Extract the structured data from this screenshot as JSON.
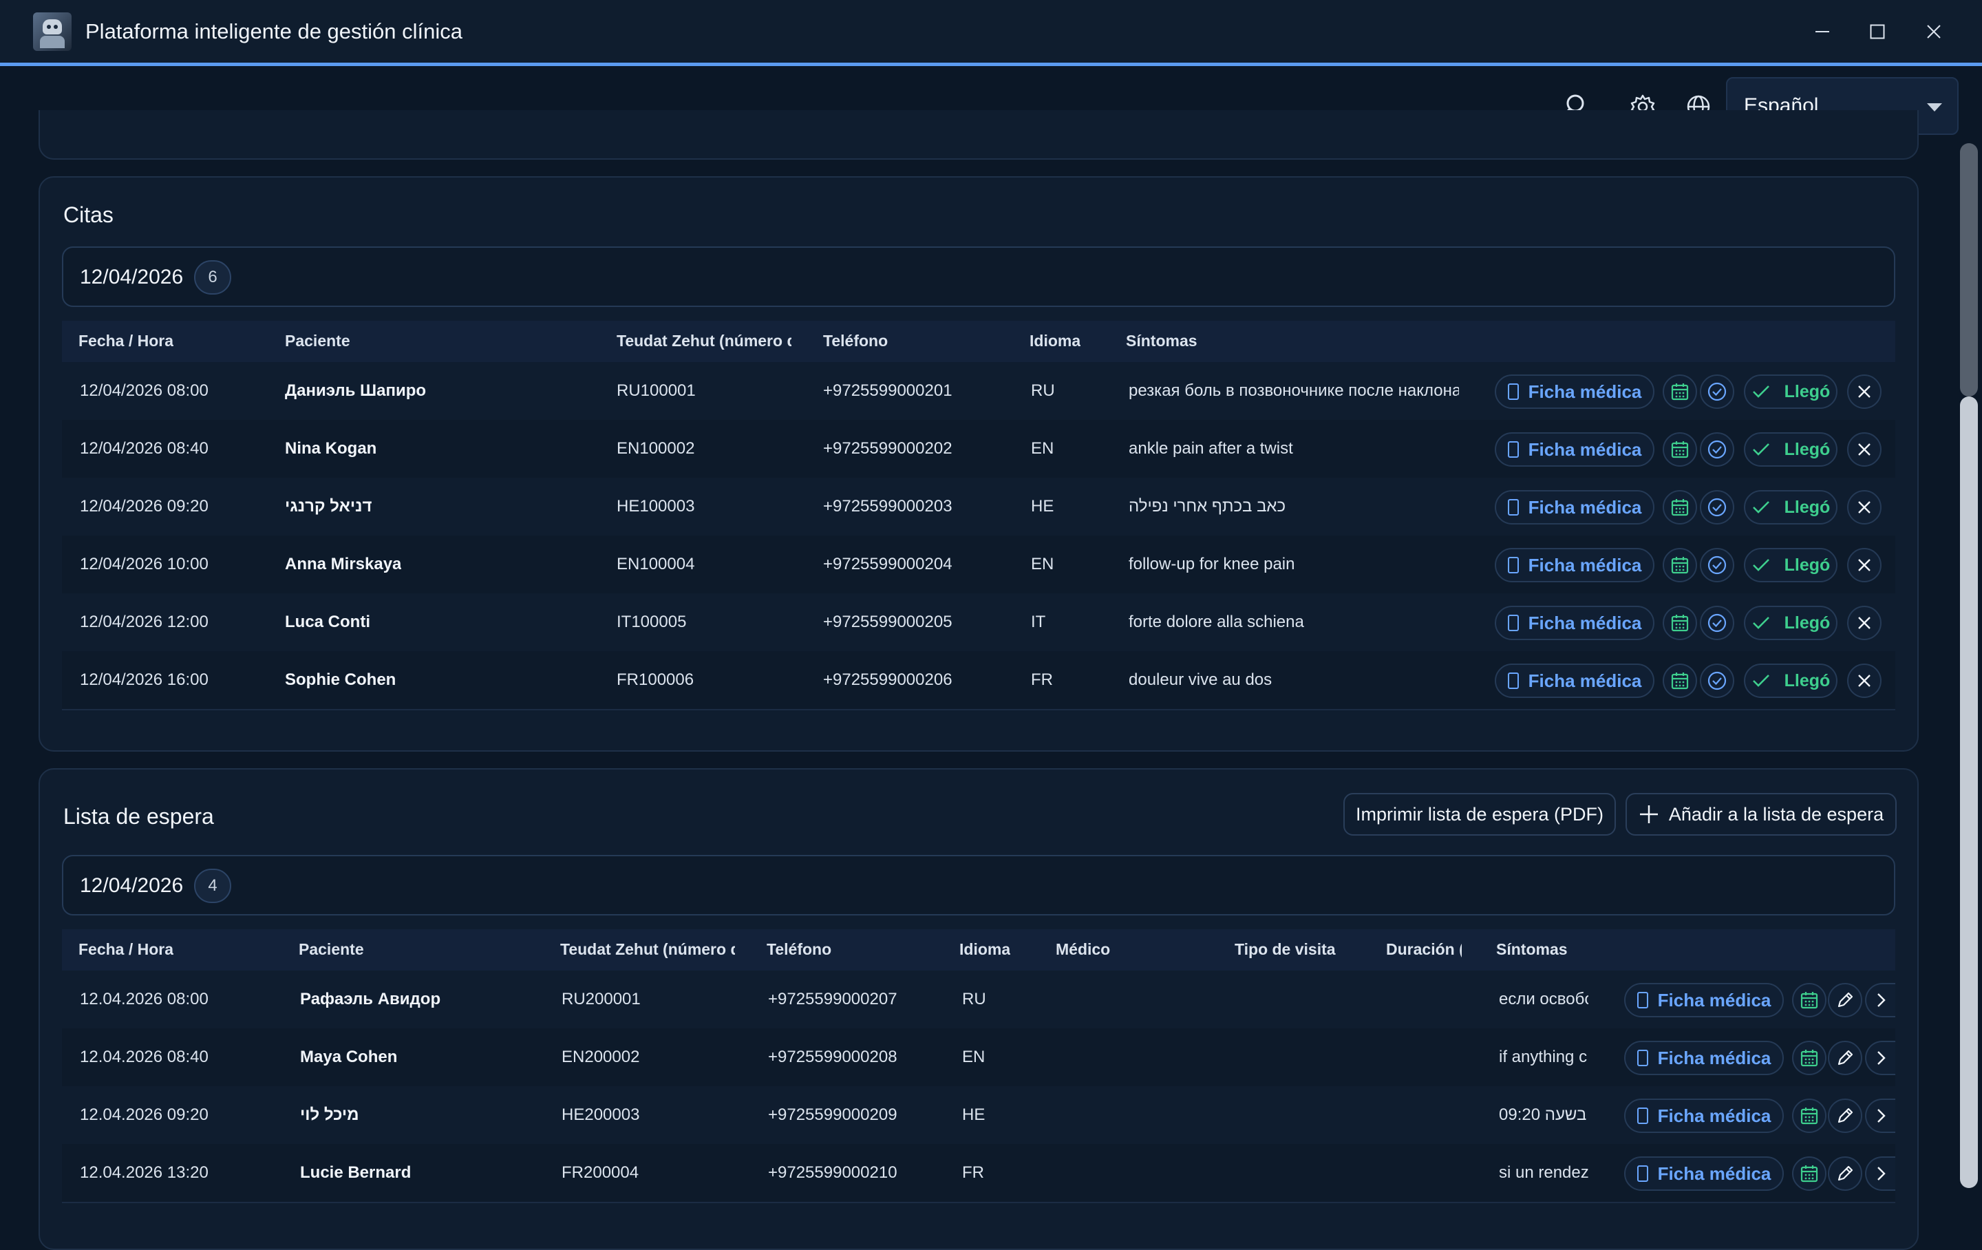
{
  "window": {
    "title": "Plataforma inteligente de gestión clínica"
  },
  "toolbar": {
    "language": "Español"
  },
  "appointments": {
    "title": "Citas",
    "date": "12/04/2026",
    "count": "6",
    "columns": [
      "Fecha / Hora",
      "Paciente",
      "Teudat Zehut (número de",
      "Teléfono",
      "Idioma",
      "Síntomas"
    ],
    "rows": [
      {
        "datetime": "12/04/2026 08:00",
        "patient": "Даниэль Шапиро",
        "id": "RU100001",
        "phone": "+9725599000201",
        "lang": "RU",
        "symptoms": "резкая боль в позвоночнике после наклона"
      },
      {
        "datetime": "12/04/2026 08:40",
        "patient": "Nina Kogan",
        "id": "EN100002",
        "phone": "+9725599000202",
        "lang": "EN",
        "symptoms": "ankle pain after a twist"
      },
      {
        "datetime": "12/04/2026 09:20",
        "patient": "דניאל קרנגי",
        "id": "HE100003",
        "phone": "+9725599000203",
        "lang": "HE",
        "symptoms": "כאב בכתף אחרי נפילה"
      },
      {
        "datetime": "12/04/2026 10:00",
        "patient": "Anna Mirskaya",
        "id": "EN100004",
        "phone": "+9725599000204",
        "lang": "EN",
        "symptoms": "follow-up for knee pain"
      },
      {
        "datetime": "12/04/2026 12:00",
        "patient": "Luca Conti",
        "id": "IT100005",
        "phone": "+9725599000205",
        "lang": "IT",
        "symptoms": "forte dolore alla schiena"
      },
      {
        "datetime": "12/04/2026 16:00",
        "patient": "Sophie Cohen",
        "id": "FR100006",
        "phone": "+9725599000206",
        "lang": "FR",
        "symptoms": "douleur vive au dos"
      }
    ],
    "actions": {
      "record": "Ficha médica",
      "arrived": "Llegó"
    }
  },
  "waitlist": {
    "title": "Lista de espera",
    "print_label": "Imprimir lista de espera (PDF)",
    "add_label": "Añadir a la lista de espera",
    "date": "12/04/2026",
    "count": "4",
    "columns": [
      "Fecha / Hora",
      "Paciente",
      "Teudat Zehut (número de",
      "Teléfono",
      "Idioma",
      "Médico",
      "Tipo de visita",
      "Duración (r",
      "Síntomas"
    ],
    "rows": [
      {
        "datetime": "12.04.2026 08:00",
        "patient": "Рафаэль Авидор",
        "id": "RU200001",
        "phone": "+9725599000207",
        "lang": "RU",
        "symptoms": "если освобо"
      },
      {
        "datetime": "12.04.2026 08:40",
        "patient": "Maya Cohen",
        "id": "EN200002",
        "phone": "+9725599000208",
        "lang": "EN",
        "symptoms": "if anything c"
      },
      {
        "datetime": "12.04.2026 09:20",
        "patient": "מיכל לוי",
        "id": "HE200003",
        "phone": "+9725599000209",
        "lang": "HE",
        "symptoms": "בשעה 09:20"
      },
      {
        "datetime": "12.04.2026 13:20",
        "patient": "Lucie Bernard",
        "id": "FR200004",
        "phone": "+9725599000210",
        "lang": "FR",
        "symptoms": "si un rendez"
      }
    ],
    "actions": {
      "record": "Ficha médica"
    }
  },
  "icons": {
    "search": "search-icon",
    "settings": "gear-icon",
    "globe": "globe-icon",
    "calendar": "calendar-icon",
    "check_circle": "check-circle-icon",
    "close": "close-icon",
    "edit": "pencil-icon",
    "next": "chevron-right-icon",
    "plus": "plus-icon",
    "document": "document-icon"
  },
  "colors": {
    "accent": "#5b9bf0",
    "link": "#6aa6ff",
    "success": "#3ecf8e",
    "background": "#0b1726",
    "panel": "#0f1d2f"
  }
}
